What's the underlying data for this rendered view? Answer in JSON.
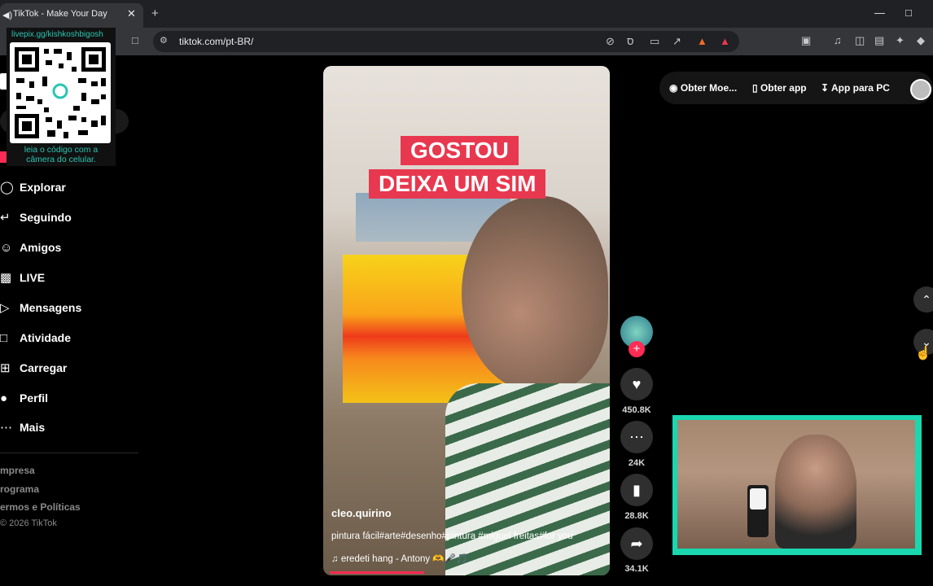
{
  "browser": {
    "tab_title": "TikTok - Make Your Day",
    "tab_audio_icon": "◀)",
    "tab_close": "✕",
    "new_tab": "+",
    "url": "tiktok.com/pt-BR/",
    "win_min": "—",
    "win_max": "□"
  },
  "qr_overlay": {
    "url": "livepix.gg/kishkoshbigosh",
    "caption_line1": "leia o código com a",
    "caption_line2": "câmera do celular."
  },
  "sidebar": {
    "items": [
      {
        "label": "Explorar",
        "icon": "compass-icon"
      },
      {
        "label": "Seguindo",
        "icon": "following-icon"
      },
      {
        "label": "Amigos",
        "icon": "friends-icon"
      },
      {
        "label": "LIVE",
        "icon": "live-icon"
      },
      {
        "label": "Mensagens",
        "icon": "messages-icon"
      },
      {
        "label": "Atividade",
        "icon": "activity-icon"
      },
      {
        "label": "Carregar",
        "icon": "upload-icon"
      },
      {
        "label": "Perfil",
        "icon": "profile-icon"
      },
      {
        "label": "Mais",
        "icon": "more-icon"
      }
    ],
    "footer": [
      "mpresa",
      "rograma",
      "ermos e Políticas"
    ],
    "copyright": "© 2026 TikTok"
  },
  "top_actions": {
    "coins": "Obter Moe...",
    "get_app": "Obter app",
    "pc_app": "App para PC"
  },
  "video": {
    "caption_line1": "GOSTOU",
    "caption_line2": "DEIXA UM SIM",
    "author": "cleo.quirino",
    "description": "pintura fácil#arte#desenho#pintura #miguel freitas#for you",
    "music": "♫  eredeti hang - Antony 🫶🎤🎵",
    "progress": 0.33
  },
  "actions": {
    "likes": "450.8K",
    "comments": "24K",
    "saves": "28.8K",
    "shares": "34.1K"
  },
  "colors": {
    "accent": "#fe2c55",
    "teal": "#29c5b2"
  }
}
